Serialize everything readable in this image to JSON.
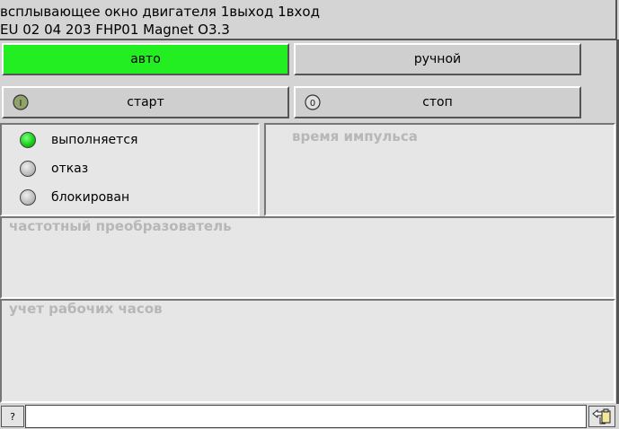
{
  "header": {
    "title_line1": "всплывающее окно двигателя 1выход 1вход",
    "title_line2": "EU  02  04  203 FHP01 Magnet O3.3"
  },
  "mode": {
    "auto_label": "авто",
    "manual_label": "ручной",
    "active": "auto",
    "active_color": "#22ee22"
  },
  "control": {
    "start_label": "старт",
    "stop_label": "стоп",
    "start_icon": "power-on-icon",
    "stop_icon": "power-off-icon",
    "start_icon_glyph": "I",
    "stop_icon_glyph": "0"
  },
  "status": {
    "items": [
      {
        "label": "выполняется",
        "state": "on"
      },
      {
        "label": "отказ",
        "state": "off"
      },
      {
        "label": "блокирован",
        "state": "off"
      }
    ],
    "on_color": "#11cc11",
    "off_color": "#bdbdbd"
  },
  "panels": {
    "pulse_time_title": "время импульса",
    "frequency_converter_title": "частотный преобразователь",
    "operating_hours_title": "учет рабочих часов"
  },
  "bottom": {
    "help_label": "?",
    "status_text": "",
    "corner_icon": "clipboard-back-icon"
  }
}
